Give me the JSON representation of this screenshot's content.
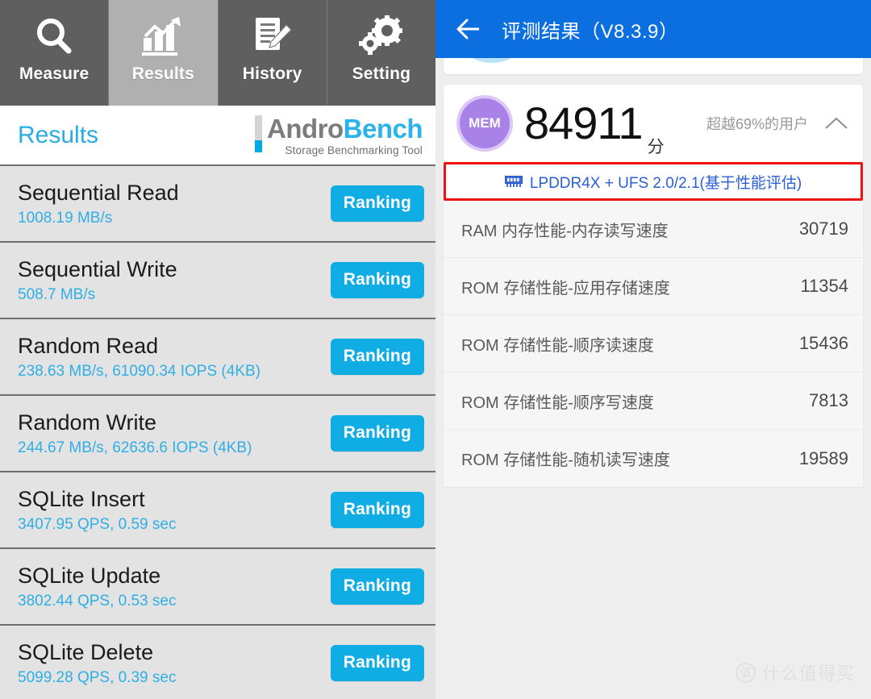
{
  "left": {
    "tabs": [
      {
        "label": "Measure",
        "icon": "magnifier-icon",
        "active": false
      },
      {
        "label": "Results",
        "icon": "bar-chart-icon",
        "active": true
      },
      {
        "label": "History",
        "icon": "document-pencil-icon",
        "active": false
      },
      {
        "label": "Setting",
        "icon": "gears-icon",
        "active": false
      }
    ],
    "page_title": "Results",
    "logo": {
      "part1": "Andro",
      "part2": "Bench",
      "tagline": "Storage Benchmarking Tool"
    },
    "ranking_label": "Ranking",
    "rows": [
      {
        "title": "Sequential Read",
        "value": "1008.19 MB/s"
      },
      {
        "title": "Sequential Write",
        "value": "508.7 MB/s"
      },
      {
        "title": "Random Read",
        "value": "238.63 MB/s, 61090.34 IOPS (4KB)"
      },
      {
        "title": "Random Write",
        "value": "244.67 MB/s, 62636.6 IOPS (4KB)"
      },
      {
        "title": "SQLite Insert",
        "value": "3407.95 QPS, 0.59 sec"
      },
      {
        "title": "SQLite Update",
        "value": "3802.44 QPS, 0.53 sec"
      },
      {
        "title": "SQLite Delete",
        "value": "5099.28 QPS, 0.39 sec"
      }
    ]
  },
  "right": {
    "header": {
      "title": "评测结果（V8.3.9）",
      "back_icon": "back-arrow-icon"
    },
    "score": {
      "badge": "MEM",
      "value": "84911",
      "unit": "分",
      "percentile": "超越69%的用户",
      "collapse_icon": "chevron-up-icon"
    },
    "highlight": {
      "icon": "ram-module-icon",
      "text": "LPDDR4X + UFS 2.0/2.1(基于性能评估)",
      "border_color": "#ee1111",
      "text_color": "#2a5fd8"
    },
    "details": [
      {
        "label": "RAM 内存性能-内存读写速度",
        "value": "30719"
      },
      {
        "label": "ROM 存储性能-应用存储速度",
        "value": "11354"
      },
      {
        "label": "ROM 存储性能-顺序读速度",
        "value": "15436"
      },
      {
        "label": "ROM 存储性能-顺序写速度",
        "value": "7813"
      },
      {
        "label": "ROM 存储性能-随机读写速度",
        "value": "19589"
      }
    ],
    "watermark": {
      "mark": "值",
      "text": "什么值得买"
    }
  },
  "colors": {
    "accent_cyan": "#10ace4",
    "header_blue": "#0b6fe0",
    "badge_purple": "#a982e8",
    "highlight_red": "#ee1111"
  }
}
